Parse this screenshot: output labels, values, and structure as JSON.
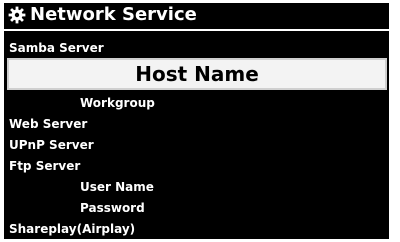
{
  "header": {
    "icon": "gear-icon",
    "title": "Network Service"
  },
  "menu": {
    "items": [
      {
        "label": "Samba Server",
        "level": 0,
        "selected": false
      },
      {
        "label": "Host Name",
        "level": 1,
        "selected": true
      },
      {
        "label": "Workgroup",
        "level": 1,
        "selected": false
      },
      {
        "label": "Web Server",
        "level": 0,
        "selected": false
      },
      {
        "label": "UPnP Server",
        "level": 0,
        "selected": false
      },
      {
        "label": "Ftp Server",
        "level": 0,
        "selected": false
      },
      {
        "label": "User Name",
        "level": 1,
        "selected": false
      },
      {
        "label": "Password",
        "level": 1,
        "selected": false
      },
      {
        "label": "Shareplay(Airplay)",
        "level": 0,
        "selected": false
      }
    ]
  },
  "colors": {
    "screen_background": "#000000",
    "text": "#ffffff",
    "highlight_background": "#f3f3f3",
    "highlight_text": "#000000"
  }
}
